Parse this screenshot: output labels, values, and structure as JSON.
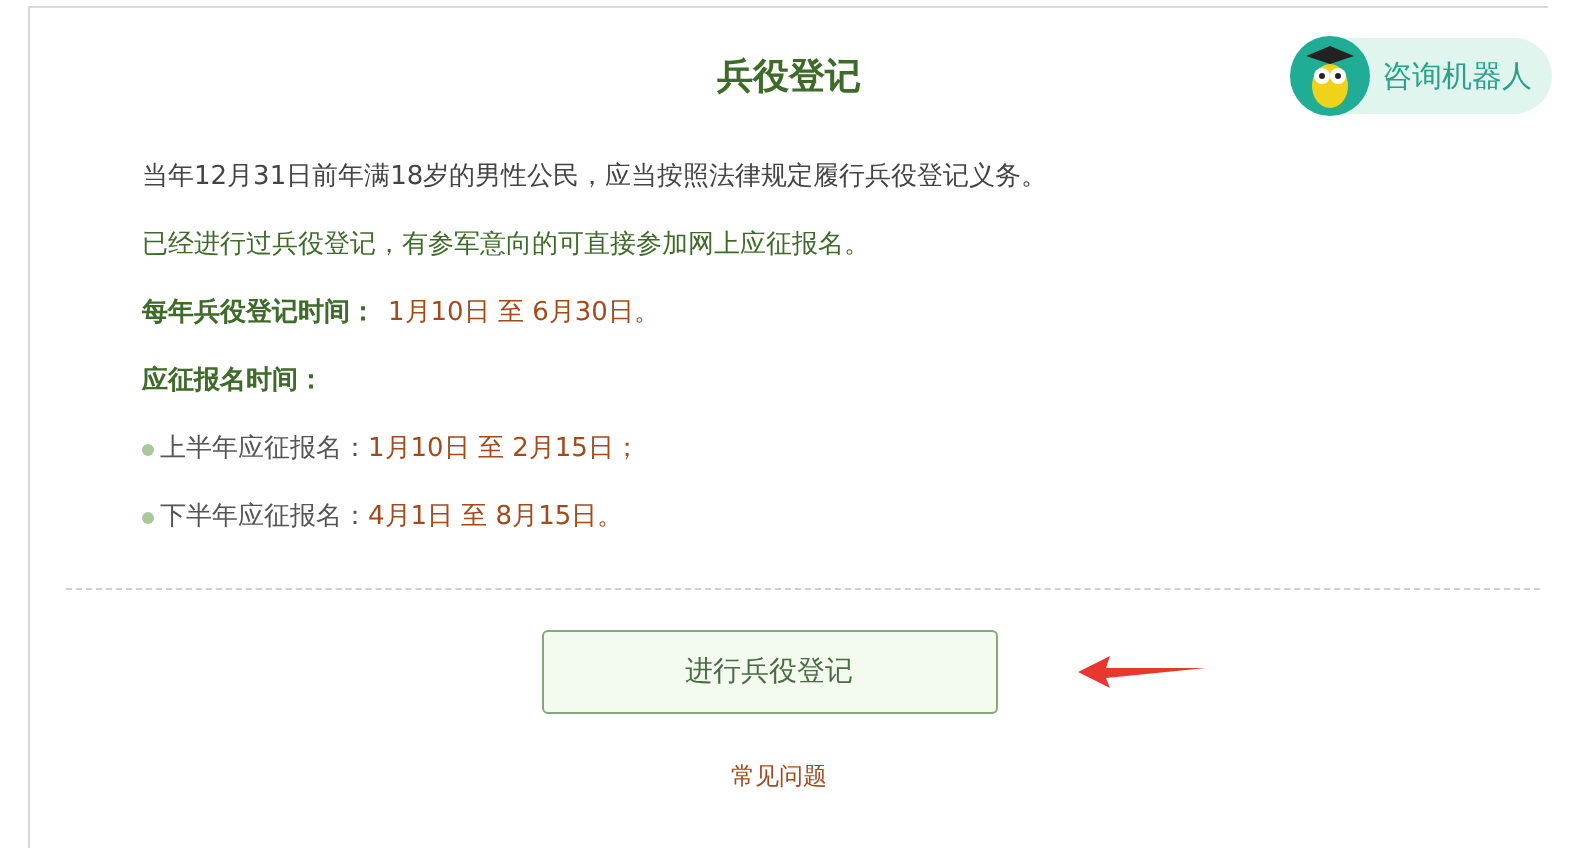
{
  "title": "兵役登记",
  "robot_button": {
    "label": "咨询机器人"
  },
  "paragraphs": [
    {
      "text": "当年12月31日前年满18岁的男性公民，应当按照法律规定履行兵役登记义务。",
      "kind": "plain"
    },
    {
      "text": "已经进行过兵役登记，有参军意向的可直接参加网上应征报名。",
      "kind": "note"
    }
  ],
  "registration_time": {
    "label": "每年兵役登记时间：",
    "value": "1月10日 至 6月30日。"
  },
  "enlistment": {
    "label": "应征报名时间：",
    "items": [
      {
        "label": "上半年应征报名：",
        "value": "1月10日 至 2月15日；"
      },
      {
        "label": "下半年应征报名：",
        "value": "4月1日 至 8月15日。"
      }
    ]
  },
  "register_button": {
    "label": "进行兵役登记"
  },
  "faq_link": {
    "label": "常见问题"
  }
}
